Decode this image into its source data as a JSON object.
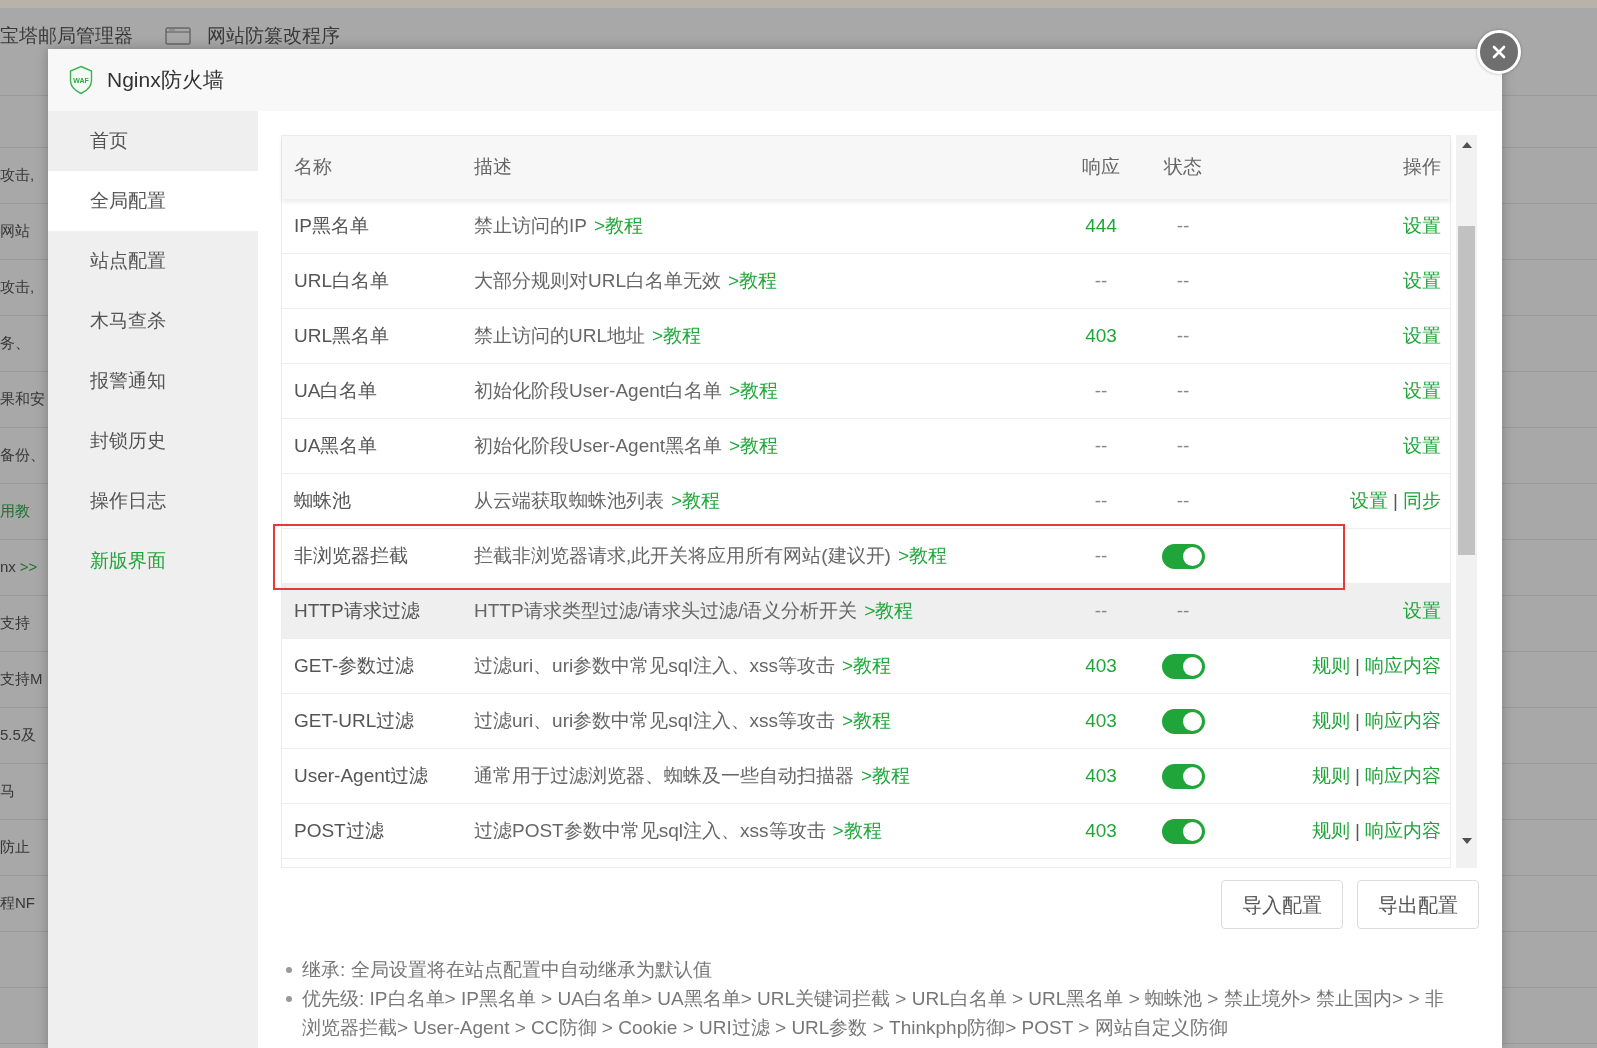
{
  "background_page": {
    "top_items": [
      {
        "label": "宝塔邮局管理器",
        "kind": "plain"
      },
      {
        "label": "网站防篡改程序",
        "kind": "with_icon"
      }
    ],
    "rows": [
      {
        "text": "攻击,"
      },
      {
        "text": "网站"
      },
      {
        "text": "攻击,"
      },
      {
        "text": "务、"
      },
      {
        "text": "果和安"
      },
      {
        "text": "备份、"
      },
      {
        "link": "用教"
      },
      {
        "text": "nx",
        "link": ">>"
      },
      {
        "text": "支持"
      },
      {
        "text": "支持M"
      },
      {
        "text": "5.5及"
      },
      {
        "text": "马"
      },
      {
        "text": "防止"
      },
      {
        "text": "程NF"
      }
    ]
  },
  "dialog": {
    "logo_text": "WAF",
    "title": "Nginx防火墙"
  },
  "sidebar": {
    "items": [
      {
        "label": "首页",
        "kind": "page",
        "selected": false
      },
      {
        "label": "全局配置",
        "kind": "page",
        "selected": true
      },
      {
        "label": "站点配置",
        "kind": "page",
        "selected": false
      },
      {
        "label": "木马查杀",
        "kind": "page",
        "selected": false
      },
      {
        "label": "报警通知",
        "kind": "page",
        "selected": false
      },
      {
        "label": "封锁历史",
        "kind": "page",
        "selected": false
      },
      {
        "label": "操作日志",
        "kind": "page",
        "selected": false
      },
      {
        "label": "新版界面",
        "kind": "link",
        "selected": false
      }
    ]
  },
  "table": {
    "columns": [
      "名称",
      "描述",
      "响应",
      "状态",
      "操作"
    ],
    "rows": [
      {
        "name": "IP黑名单",
        "description": [
          {
            "kind": "text",
            "text": "禁止访问的IP"
          },
          {
            "kind": "link",
            "text": ">教程"
          }
        ],
        "response": {
          "text": "444",
          "active": true
        },
        "status": {
          "kind": "text",
          "text": "--"
        },
        "actions": [
          {
            "kind": "link",
            "text": "设置"
          }
        ],
        "hovered": false,
        "highlighted": false
      },
      {
        "name": "URL白名单",
        "description": [
          {
            "kind": "text",
            "text": "大部分规则对URL白名单无效"
          },
          {
            "kind": "link",
            "text": ">教程"
          }
        ],
        "response": {
          "text": "--",
          "active": false
        },
        "status": {
          "kind": "text",
          "text": "--"
        },
        "actions": [
          {
            "kind": "link",
            "text": "设置"
          }
        ],
        "hovered": false,
        "highlighted": false
      },
      {
        "name": "URL黑名单",
        "description": [
          {
            "kind": "text",
            "text": "禁止访问的URL地址"
          },
          {
            "kind": "link",
            "text": ">教程"
          }
        ],
        "response": {
          "text": "403",
          "active": true
        },
        "status": {
          "kind": "text",
          "text": "--"
        },
        "actions": [
          {
            "kind": "link",
            "text": "设置"
          }
        ],
        "hovered": false,
        "highlighted": false
      },
      {
        "name": "UA白名单",
        "description": [
          {
            "kind": "text",
            "text": "初始化阶段User-Agent白名单"
          },
          {
            "kind": "link",
            "text": ">教程"
          }
        ],
        "response": {
          "text": "--",
          "active": false
        },
        "status": {
          "kind": "text",
          "text": "--"
        },
        "actions": [
          {
            "kind": "link",
            "text": "设置"
          }
        ],
        "hovered": false,
        "highlighted": false
      },
      {
        "name": "UA黑名单",
        "description": [
          {
            "kind": "text",
            "text": "初始化阶段User-Agent黑名单"
          },
          {
            "kind": "link",
            "text": ">教程"
          }
        ],
        "response": {
          "text": "--",
          "active": false
        },
        "status": {
          "kind": "text",
          "text": "--"
        },
        "actions": [
          {
            "kind": "link",
            "text": "设置"
          }
        ],
        "hovered": false,
        "highlighted": false
      },
      {
        "name": "蜘蛛池",
        "description": [
          {
            "kind": "text",
            "text": "从云端获取蜘蛛池列表"
          },
          {
            "kind": "link",
            "text": ">教程"
          }
        ],
        "response": {
          "text": "--",
          "active": false
        },
        "status": {
          "kind": "text",
          "text": "--"
        },
        "actions": [
          {
            "kind": "link",
            "text": "设置"
          },
          {
            "kind": "separator",
            "text": "|"
          },
          {
            "kind": "link",
            "text": "同步"
          }
        ],
        "hovered": false,
        "highlighted": false
      },
      {
        "name": "非浏览器拦截",
        "description": [
          {
            "kind": "text",
            "text": "拦截非浏览器请求,此开关将应用所有网站(建议开)"
          },
          {
            "kind": "link",
            "text": ">教程"
          }
        ],
        "response": {
          "text": "--",
          "active": false
        },
        "status": {
          "kind": "toggle",
          "on": true
        },
        "hovered": false,
        "highlighted": true
      },
      {
        "name": "HTTP请求过滤",
        "description": [
          {
            "kind": "text",
            "text": "HTTP请求类型过滤/请求头过滤/语义分析开关"
          },
          {
            "kind": "link",
            "text": ">教程"
          }
        ],
        "response": {
          "text": "--",
          "active": false
        },
        "status": {
          "kind": "text",
          "text": "--"
        },
        "actions": [
          {
            "kind": "link",
            "text": "设置"
          }
        ],
        "hovered": true,
        "highlighted": false
      },
      {
        "name": "GET-参数过滤",
        "description": [
          {
            "kind": "text",
            "text": "过滤uri、uri参数中常见sql注入、xss等攻击"
          },
          {
            "kind": "link",
            "text": ">教程"
          }
        ],
        "response": {
          "text": "403",
          "active": true
        },
        "status": {
          "kind": "toggle",
          "on": true
        },
        "actions": [
          {
            "kind": "link",
            "text": "规则"
          },
          {
            "kind": "separator",
            "text": "|"
          },
          {
            "kind": "link",
            "text": "响应内容"
          }
        ],
        "hovered": false,
        "highlighted": false
      },
      {
        "name": "GET-URL过滤",
        "description": [
          {
            "kind": "text",
            "text": "过滤uri、uri参数中常见sql注入、xss等攻击"
          },
          {
            "kind": "link",
            "text": ">教程"
          }
        ],
        "response": {
          "text": "403",
          "active": true
        },
        "status": {
          "kind": "toggle",
          "on": true
        },
        "actions": [
          {
            "kind": "link",
            "text": "规则"
          },
          {
            "kind": "separator",
            "text": "|"
          },
          {
            "kind": "link",
            "text": "响应内容"
          }
        ],
        "hovered": false,
        "highlighted": false
      },
      {
        "name": "User-Agent过滤",
        "description": [
          {
            "kind": "text",
            "text": "通常用于过滤浏览器、蜘蛛及一些自动扫描器"
          },
          {
            "kind": "link",
            "text": ">教程"
          }
        ],
        "response": {
          "text": "403",
          "active": true
        },
        "status": {
          "kind": "toggle",
          "on": true
        },
        "actions": [
          {
            "kind": "link",
            "text": "规则"
          },
          {
            "kind": "separator",
            "text": "|"
          },
          {
            "kind": "link",
            "text": "响应内容"
          }
        ],
        "hovered": false,
        "highlighted": false
      },
      {
        "name": "POST过滤",
        "description": [
          {
            "kind": "text",
            "text": "过滤POST参数中常见sql注入、xss等攻击"
          },
          {
            "kind": "link",
            "text": ">教程"
          }
        ],
        "response": {
          "text": "403",
          "active": true
        },
        "status": {
          "kind": "toggle",
          "on": true
        },
        "actions": [
          {
            "kind": "link",
            "text": "规则"
          },
          {
            "kind": "separator",
            "text": "|"
          },
          {
            "kind": "link",
            "text": "响应内容"
          }
        ],
        "hovered": false,
        "highlighted": false
      }
    ]
  },
  "buttons": [
    "导入配置",
    "导出配置"
  ],
  "notes": [
    "继承: 全局设置将在站点配置中自动继承为默认值",
    "优先级: IP白名单> IP黑名单 > UA白名单> UA黑名单> URL关键词拦截 > URL白名单 > URL黑名单 > 蜘蛛池 > 禁止境外> 禁止国内> > 非浏览器拦截> User-Agent > CC防御 > Cookie > URI过滤 > URL参数 > Thinkphp防御> POST > 网站自定义防御"
  ]
}
